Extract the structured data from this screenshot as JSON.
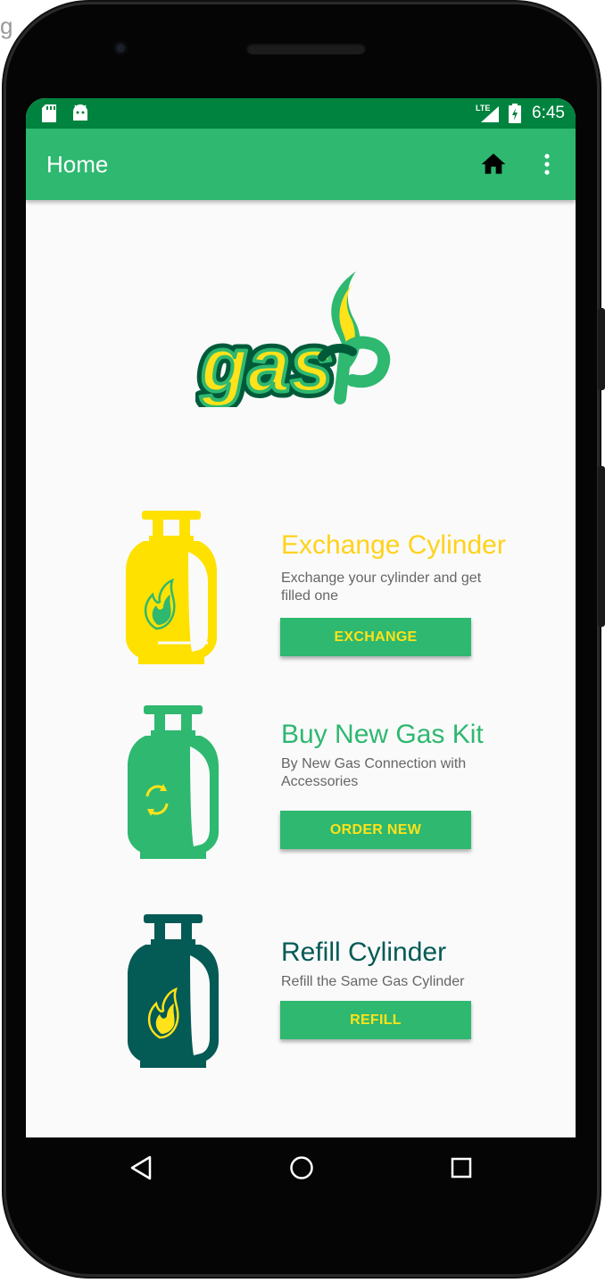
{
  "edge_fragment": "g",
  "status_bar": {
    "time": "6:45",
    "network_label": "LTE",
    "left_icons": [
      "sd-card-icon",
      "android-icon"
    ],
    "right_icons": [
      "signal-icon",
      "battery-icon"
    ]
  },
  "app_bar": {
    "title": "Home",
    "actions": [
      "home-icon",
      "more-vert-icon"
    ]
  },
  "logo": {
    "text": "gas",
    "colors": {
      "green": "#2eb870",
      "yellow": "#ffe21a",
      "dark_green": "#005a3a"
    }
  },
  "cards": [
    {
      "title": "Exchange Cylinder",
      "description": "Exchange your cylinder and get filled one",
      "button": "EXCHANGE",
      "icon": "gas-cylinder-flame-icon",
      "color": "#ffe100"
    },
    {
      "title": "Buy New Gas Kit",
      "description": "By New Gas  Connection with Accessories",
      "button": "ORDER NEW",
      "icon": "gas-cylinder-refresh-icon",
      "color": "#2eb870"
    },
    {
      "title": "Refill Cylinder",
      "description": "Refill the Same Gas Cylinder",
      "button": "REFILL",
      "icon": "gas-cylinder-flame-icon",
      "color": "#045a55"
    }
  ],
  "nav_bar": {
    "buttons": [
      "back-icon",
      "home-circle-icon",
      "recents-icon"
    ]
  },
  "colors": {
    "status_bar": "#00833e",
    "app_bar": "#2eb870",
    "button_text": "#ffe21a",
    "background": "#fafafa"
  }
}
